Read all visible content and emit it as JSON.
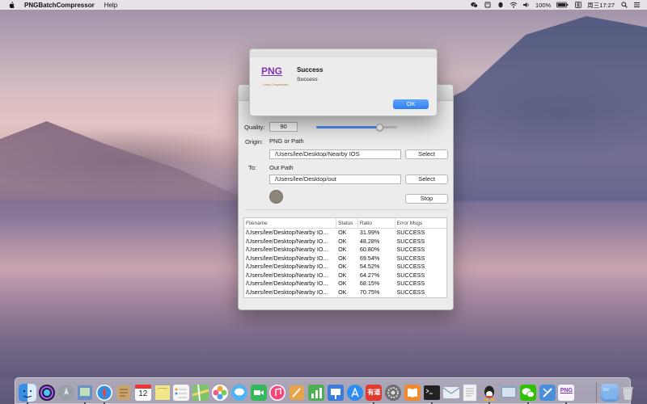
{
  "menubar": {
    "app_name": "PNGBatchCompressor",
    "menus": [
      "Help"
    ],
    "battery": "100%",
    "clock": "周三17:27"
  },
  "main_window": {
    "quality_label": "Quality:",
    "quality_value": "90",
    "quality_slider_fraction": 0.78,
    "origin_label": "Origin:",
    "origin_hint": "PNG or Path",
    "origin_path": "/Users/lee/Desktop/Nearby IOS",
    "origin_select": "Select",
    "to_label": "To:",
    "out_hint": "Out Path",
    "out_path": "/Users/lee/Desktop/out",
    "out_select": "Select",
    "stop_button": "Stop",
    "table": {
      "headers": [
        "Filename",
        "Status",
        "Ratio",
        "Error Msgs"
      ],
      "rows": [
        [
          "/Users/lee/Desktop/Nearby IO...",
          "OK",
          "31.99%",
          "SUCCESS"
        ],
        [
          "/Users/lee/Desktop/Nearby IO...",
          "OK",
          "48.28%",
          "SUCCESS"
        ],
        [
          "/Users/lee/Desktop/Nearby IO...",
          "OK",
          "60.80%",
          "SUCCESS"
        ],
        [
          "/Users/lee/Desktop/Nearby IO...",
          "OK",
          "69.54%",
          "SUCCESS"
        ],
        [
          "/Users/lee/Desktop/Nearby IO...",
          "OK",
          "54.52%",
          "SUCCESS"
        ],
        [
          "/Users/lee/Desktop/Nearby IO...",
          "OK",
          "64.27%",
          "SUCCESS"
        ],
        [
          "/Users/lee/Desktop/Nearby IO...",
          "OK",
          "68.15%",
          "SUCCESS"
        ],
        [
          "/Users/lee/Desktop/Nearby IO...",
          "OK",
          "70.75%",
          "SUCCESS"
        ]
      ]
    }
  },
  "alert": {
    "icon_text": "PNG",
    "icon_sub": "Lossy Compression",
    "title": "Success",
    "message": "Success",
    "ok_button": "OK"
  },
  "dock": {
    "calendar_day": "12",
    "youdao_label": "有道",
    "png_label": "PNG",
    "apps": [
      {
        "name": "finder",
        "color": "#3a8ee6",
        "running": true
      },
      {
        "name": "siri",
        "color": "#5a4fc9",
        "running": false
      },
      {
        "name": "launchpad",
        "color": "#8c8c8c",
        "running": false
      },
      {
        "name": "preview",
        "color": "#6b90c7",
        "running": true
      },
      {
        "name": "safari",
        "color": "#2f8fe6",
        "running": true
      },
      {
        "name": "notes-app",
        "color": "#c9a46b",
        "running": false
      },
      {
        "name": "calendar",
        "color": "#ffffff",
        "running": false
      },
      {
        "name": "stickies",
        "color": "#f3e58a",
        "running": false
      },
      {
        "name": "reminders",
        "color": "#f5f5f5",
        "running": false
      },
      {
        "name": "maps",
        "color": "#7fc46b",
        "running": false
      },
      {
        "name": "photos",
        "color": "#f2a23a",
        "running": false
      },
      {
        "name": "messages",
        "color": "#4fb3f5",
        "running": false
      },
      {
        "name": "facetime",
        "color": "#35b85a",
        "running": false
      },
      {
        "name": "itunes",
        "color": "#f04a7d",
        "running": false
      },
      {
        "name": "ibooks-author",
        "color": "#e8a44a",
        "running": false
      },
      {
        "name": "numbers",
        "color": "#4caf50",
        "running": false
      },
      {
        "name": "keynote",
        "color": "#3b7be0",
        "running": false
      },
      {
        "name": "app-store",
        "color": "#2c8ef2",
        "running": false
      },
      {
        "name": "youdao-dict",
        "color": "#e23a2e",
        "running": true
      },
      {
        "name": "system-preferences",
        "color": "#6f6f6f",
        "running": false
      },
      {
        "name": "ibooks",
        "color": "#f08a2c",
        "running": false
      },
      {
        "name": "terminal",
        "color": "#222222",
        "running": true
      },
      {
        "name": "mail",
        "color": "#e9eef5",
        "running": false
      },
      {
        "name": "textedit",
        "color": "#f4f4f4",
        "running": false
      },
      {
        "name": "qq",
        "color": "#222222",
        "running": true
      },
      {
        "name": "screen-capture",
        "color": "#8aa3c2",
        "running": false
      },
      {
        "name": "wechat",
        "color": "#2dc100",
        "running": true
      },
      {
        "name": "xcode",
        "color": "#4a8fdc",
        "running": false
      },
      {
        "name": "png-batch-compressor",
        "color": "#f6f3fa",
        "running": true
      }
    ]
  }
}
